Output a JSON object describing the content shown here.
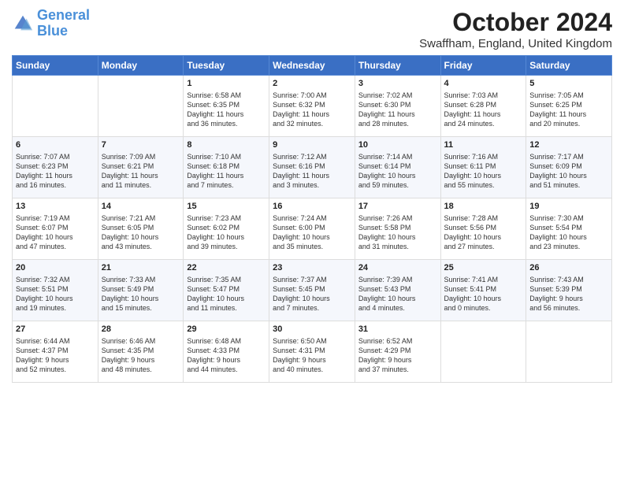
{
  "logo": {
    "line1": "General",
    "line2": "Blue"
  },
  "title": "October 2024",
  "location": "Swaffham, England, United Kingdom",
  "days_of_week": [
    "Sunday",
    "Monday",
    "Tuesday",
    "Wednesday",
    "Thursday",
    "Friday",
    "Saturday"
  ],
  "weeks": [
    [
      {
        "day": "",
        "content": ""
      },
      {
        "day": "",
        "content": ""
      },
      {
        "day": "1",
        "content": "Sunrise: 6:58 AM\nSunset: 6:35 PM\nDaylight: 11 hours\nand 36 minutes."
      },
      {
        "day": "2",
        "content": "Sunrise: 7:00 AM\nSunset: 6:32 PM\nDaylight: 11 hours\nand 32 minutes."
      },
      {
        "day": "3",
        "content": "Sunrise: 7:02 AM\nSunset: 6:30 PM\nDaylight: 11 hours\nand 28 minutes."
      },
      {
        "day": "4",
        "content": "Sunrise: 7:03 AM\nSunset: 6:28 PM\nDaylight: 11 hours\nand 24 minutes."
      },
      {
        "day": "5",
        "content": "Sunrise: 7:05 AM\nSunset: 6:25 PM\nDaylight: 11 hours\nand 20 minutes."
      }
    ],
    [
      {
        "day": "6",
        "content": "Sunrise: 7:07 AM\nSunset: 6:23 PM\nDaylight: 11 hours\nand 16 minutes."
      },
      {
        "day": "7",
        "content": "Sunrise: 7:09 AM\nSunset: 6:21 PM\nDaylight: 11 hours\nand 11 minutes."
      },
      {
        "day": "8",
        "content": "Sunrise: 7:10 AM\nSunset: 6:18 PM\nDaylight: 11 hours\nand 7 minutes."
      },
      {
        "day": "9",
        "content": "Sunrise: 7:12 AM\nSunset: 6:16 PM\nDaylight: 11 hours\nand 3 minutes."
      },
      {
        "day": "10",
        "content": "Sunrise: 7:14 AM\nSunset: 6:14 PM\nDaylight: 10 hours\nand 59 minutes."
      },
      {
        "day": "11",
        "content": "Sunrise: 7:16 AM\nSunset: 6:11 PM\nDaylight: 10 hours\nand 55 minutes."
      },
      {
        "day": "12",
        "content": "Sunrise: 7:17 AM\nSunset: 6:09 PM\nDaylight: 10 hours\nand 51 minutes."
      }
    ],
    [
      {
        "day": "13",
        "content": "Sunrise: 7:19 AM\nSunset: 6:07 PM\nDaylight: 10 hours\nand 47 minutes."
      },
      {
        "day": "14",
        "content": "Sunrise: 7:21 AM\nSunset: 6:05 PM\nDaylight: 10 hours\nand 43 minutes."
      },
      {
        "day": "15",
        "content": "Sunrise: 7:23 AM\nSunset: 6:02 PM\nDaylight: 10 hours\nand 39 minutes."
      },
      {
        "day": "16",
        "content": "Sunrise: 7:24 AM\nSunset: 6:00 PM\nDaylight: 10 hours\nand 35 minutes."
      },
      {
        "day": "17",
        "content": "Sunrise: 7:26 AM\nSunset: 5:58 PM\nDaylight: 10 hours\nand 31 minutes."
      },
      {
        "day": "18",
        "content": "Sunrise: 7:28 AM\nSunset: 5:56 PM\nDaylight: 10 hours\nand 27 minutes."
      },
      {
        "day": "19",
        "content": "Sunrise: 7:30 AM\nSunset: 5:54 PM\nDaylight: 10 hours\nand 23 minutes."
      }
    ],
    [
      {
        "day": "20",
        "content": "Sunrise: 7:32 AM\nSunset: 5:51 PM\nDaylight: 10 hours\nand 19 minutes."
      },
      {
        "day": "21",
        "content": "Sunrise: 7:33 AM\nSunset: 5:49 PM\nDaylight: 10 hours\nand 15 minutes."
      },
      {
        "day": "22",
        "content": "Sunrise: 7:35 AM\nSunset: 5:47 PM\nDaylight: 10 hours\nand 11 minutes."
      },
      {
        "day": "23",
        "content": "Sunrise: 7:37 AM\nSunset: 5:45 PM\nDaylight: 10 hours\nand 7 minutes."
      },
      {
        "day": "24",
        "content": "Sunrise: 7:39 AM\nSunset: 5:43 PM\nDaylight: 10 hours\nand 4 minutes."
      },
      {
        "day": "25",
        "content": "Sunrise: 7:41 AM\nSunset: 5:41 PM\nDaylight: 10 hours\nand 0 minutes."
      },
      {
        "day": "26",
        "content": "Sunrise: 7:43 AM\nSunset: 5:39 PM\nDaylight: 9 hours\nand 56 minutes."
      }
    ],
    [
      {
        "day": "27",
        "content": "Sunrise: 6:44 AM\nSunset: 4:37 PM\nDaylight: 9 hours\nand 52 minutes."
      },
      {
        "day": "28",
        "content": "Sunrise: 6:46 AM\nSunset: 4:35 PM\nDaylight: 9 hours\nand 48 minutes."
      },
      {
        "day": "29",
        "content": "Sunrise: 6:48 AM\nSunset: 4:33 PM\nDaylight: 9 hours\nand 44 minutes."
      },
      {
        "day": "30",
        "content": "Sunrise: 6:50 AM\nSunset: 4:31 PM\nDaylight: 9 hours\nand 40 minutes."
      },
      {
        "day": "31",
        "content": "Sunrise: 6:52 AM\nSunset: 4:29 PM\nDaylight: 9 hours\nand 37 minutes."
      },
      {
        "day": "",
        "content": ""
      },
      {
        "day": "",
        "content": ""
      }
    ]
  ]
}
